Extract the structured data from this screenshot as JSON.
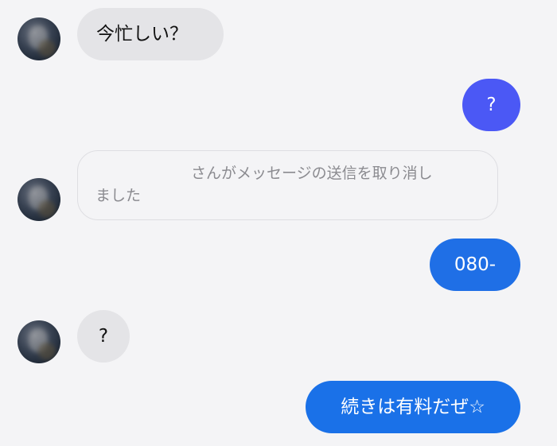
{
  "conversation": {
    "messages": [
      {
        "sender": "other",
        "text": "今忙しい？"
      },
      {
        "sender": "self",
        "text": "?",
        "bubble_color": "#4b58f5"
      },
      {
        "sender": "other",
        "type": "unsent_notice",
        "line1": "さんがメッセージの送信を取り消し",
        "line2": "ました"
      },
      {
        "sender": "self",
        "text": "080-",
        "bubble_color": "#1f6fe6"
      },
      {
        "sender": "other",
        "text": "?"
      },
      {
        "sender": "self",
        "text": "続きは有料だぜ☆",
        "bubble_color": "#1a71e8"
      }
    ]
  },
  "colors": {
    "background": "#f4f4f6",
    "incoming_bubble": "#e4e4e7",
    "notice_text": "#8b8b90"
  },
  "icons": {
    "avatar": "blurred-profile-photo"
  }
}
